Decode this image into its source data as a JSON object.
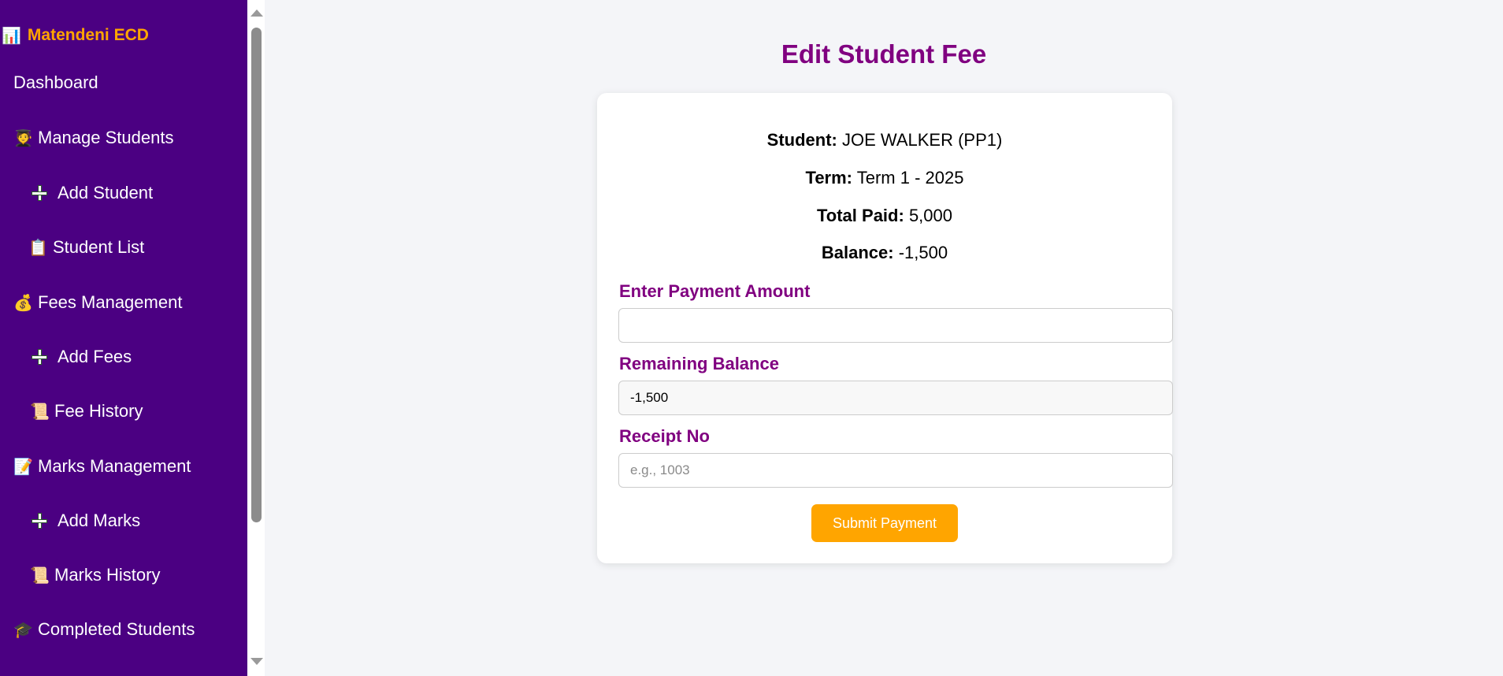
{
  "sidebar": {
    "brand": {
      "icon": "bar-chart-icon",
      "glyph": "📊",
      "title": "Matendeni ECD"
    },
    "items": [
      {
        "label": "Dashboard",
        "icon": "",
        "glyph": ""
      },
      {
        "label": "Manage Students",
        "icon": "student-icon",
        "glyph": "🧑‍🎓"
      },
      {
        "label": "Add Student",
        "icon": "plus-icon",
        "glyph": ""
      },
      {
        "label": "Student List",
        "icon": "clipboard-icon",
        "glyph": "📋"
      },
      {
        "label": "Fees Management",
        "icon": "money-bag-icon",
        "glyph": "💰"
      },
      {
        "label": "Add Fees",
        "icon": "plus-icon",
        "glyph": ""
      },
      {
        "label": "Fee History",
        "icon": "scroll-icon",
        "glyph": "📜"
      },
      {
        "label": "Marks Management",
        "icon": "memo-icon",
        "glyph": "📝"
      },
      {
        "label": "Add Marks",
        "icon": "plus-icon",
        "glyph": ""
      },
      {
        "label": "Marks History",
        "icon": "scroll-icon",
        "glyph": "📜"
      },
      {
        "label": "Completed Students",
        "icon": "graduation-cap-icon",
        "glyph": "🎓"
      }
    ]
  },
  "main": {
    "title": "Edit Student Fee",
    "info": {
      "student_label": "Student:",
      "student_value": "JOE WALKER (PP1)",
      "term_label": "Term:",
      "term_value": "Term 1 - 2025",
      "paid_label": "Total Paid:",
      "paid_value": "5,000",
      "balance_label": "Balance:",
      "balance_value": "-1,500"
    },
    "form": {
      "amount_label": "Enter Payment Amount",
      "amount_value": "",
      "remaining_label": "Remaining Balance",
      "remaining_value": "-1,500",
      "receipt_label": "Receipt No",
      "receipt_placeholder": "e.g., 1003",
      "submit_label": "Submit Payment"
    }
  },
  "colors": {
    "sidebar_bg": "#4b0082",
    "brand": "#ffa500",
    "accent_purple": "#800080",
    "button": "#ffa500",
    "page_bg": "#f4f5f8"
  }
}
